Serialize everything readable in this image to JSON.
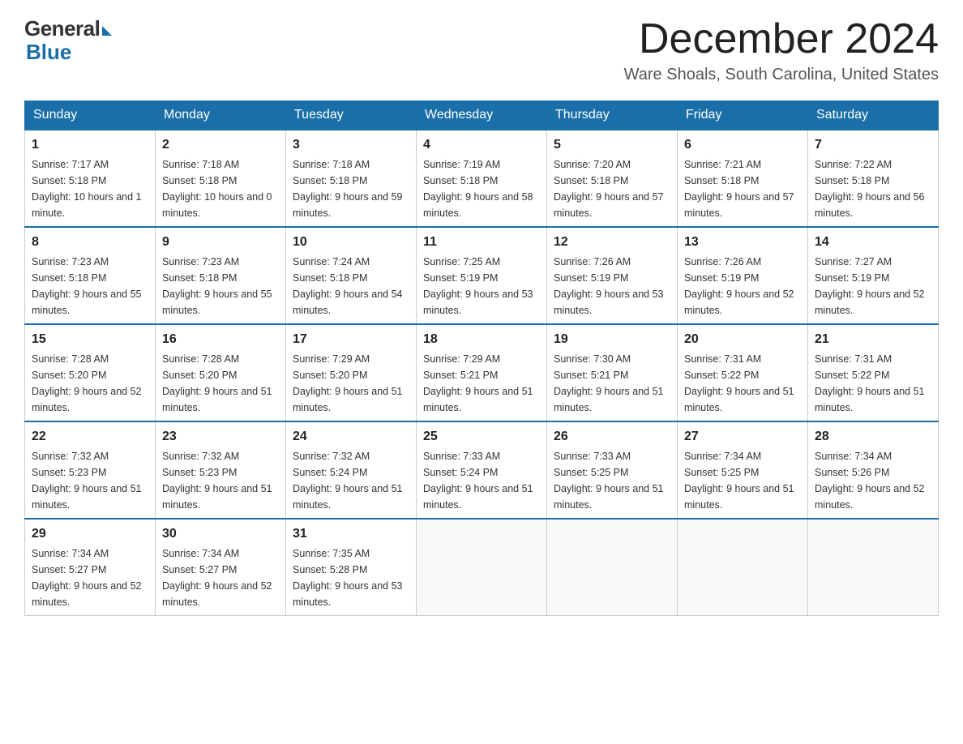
{
  "logo": {
    "general": "General",
    "blue": "Blue"
  },
  "title": {
    "month": "December 2024",
    "location": "Ware Shoals, South Carolina, United States"
  },
  "days_of_week": [
    "Sunday",
    "Monday",
    "Tuesday",
    "Wednesday",
    "Thursday",
    "Friday",
    "Saturday"
  ],
  "weeks": [
    [
      {
        "day": "1",
        "sunrise": "7:17 AM",
        "sunset": "5:18 PM",
        "daylight": "10 hours and 1 minute."
      },
      {
        "day": "2",
        "sunrise": "7:18 AM",
        "sunset": "5:18 PM",
        "daylight": "10 hours and 0 minutes."
      },
      {
        "day": "3",
        "sunrise": "7:18 AM",
        "sunset": "5:18 PM",
        "daylight": "9 hours and 59 minutes."
      },
      {
        "day": "4",
        "sunrise": "7:19 AM",
        "sunset": "5:18 PM",
        "daylight": "9 hours and 58 minutes."
      },
      {
        "day": "5",
        "sunrise": "7:20 AM",
        "sunset": "5:18 PM",
        "daylight": "9 hours and 57 minutes."
      },
      {
        "day": "6",
        "sunrise": "7:21 AM",
        "sunset": "5:18 PM",
        "daylight": "9 hours and 57 minutes."
      },
      {
        "day": "7",
        "sunrise": "7:22 AM",
        "sunset": "5:18 PM",
        "daylight": "9 hours and 56 minutes."
      }
    ],
    [
      {
        "day": "8",
        "sunrise": "7:23 AM",
        "sunset": "5:18 PM",
        "daylight": "9 hours and 55 minutes."
      },
      {
        "day": "9",
        "sunrise": "7:23 AM",
        "sunset": "5:18 PM",
        "daylight": "9 hours and 55 minutes."
      },
      {
        "day": "10",
        "sunrise": "7:24 AM",
        "sunset": "5:18 PM",
        "daylight": "9 hours and 54 minutes."
      },
      {
        "day": "11",
        "sunrise": "7:25 AM",
        "sunset": "5:19 PM",
        "daylight": "9 hours and 53 minutes."
      },
      {
        "day": "12",
        "sunrise": "7:26 AM",
        "sunset": "5:19 PM",
        "daylight": "9 hours and 53 minutes."
      },
      {
        "day": "13",
        "sunrise": "7:26 AM",
        "sunset": "5:19 PM",
        "daylight": "9 hours and 52 minutes."
      },
      {
        "day": "14",
        "sunrise": "7:27 AM",
        "sunset": "5:19 PM",
        "daylight": "9 hours and 52 minutes."
      }
    ],
    [
      {
        "day": "15",
        "sunrise": "7:28 AM",
        "sunset": "5:20 PM",
        "daylight": "9 hours and 52 minutes."
      },
      {
        "day": "16",
        "sunrise": "7:28 AM",
        "sunset": "5:20 PM",
        "daylight": "9 hours and 51 minutes."
      },
      {
        "day": "17",
        "sunrise": "7:29 AM",
        "sunset": "5:20 PM",
        "daylight": "9 hours and 51 minutes."
      },
      {
        "day": "18",
        "sunrise": "7:29 AM",
        "sunset": "5:21 PM",
        "daylight": "9 hours and 51 minutes."
      },
      {
        "day": "19",
        "sunrise": "7:30 AM",
        "sunset": "5:21 PM",
        "daylight": "9 hours and 51 minutes."
      },
      {
        "day": "20",
        "sunrise": "7:31 AM",
        "sunset": "5:22 PM",
        "daylight": "9 hours and 51 minutes."
      },
      {
        "day": "21",
        "sunrise": "7:31 AM",
        "sunset": "5:22 PM",
        "daylight": "9 hours and 51 minutes."
      }
    ],
    [
      {
        "day": "22",
        "sunrise": "7:32 AM",
        "sunset": "5:23 PM",
        "daylight": "9 hours and 51 minutes."
      },
      {
        "day": "23",
        "sunrise": "7:32 AM",
        "sunset": "5:23 PM",
        "daylight": "9 hours and 51 minutes."
      },
      {
        "day": "24",
        "sunrise": "7:32 AM",
        "sunset": "5:24 PM",
        "daylight": "9 hours and 51 minutes."
      },
      {
        "day": "25",
        "sunrise": "7:33 AM",
        "sunset": "5:24 PM",
        "daylight": "9 hours and 51 minutes."
      },
      {
        "day": "26",
        "sunrise": "7:33 AM",
        "sunset": "5:25 PM",
        "daylight": "9 hours and 51 minutes."
      },
      {
        "day": "27",
        "sunrise": "7:34 AM",
        "sunset": "5:25 PM",
        "daylight": "9 hours and 51 minutes."
      },
      {
        "day": "28",
        "sunrise": "7:34 AM",
        "sunset": "5:26 PM",
        "daylight": "9 hours and 52 minutes."
      }
    ],
    [
      {
        "day": "29",
        "sunrise": "7:34 AM",
        "sunset": "5:27 PM",
        "daylight": "9 hours and 52 minutes."
      },
      {
        "day": "30",
        "sunrise": "7:34 AM",
        "sunset": "5:27 PM",
        "daylight": "9 hours and 52 minutes."
      },
      {
        "day": "31",
        "sunrise": "7:35 AM",
        "sunset": "5:28 PM",
        "daylight": "9 hours and 53 minutes."
      },
      null,
      null,
      null,
      null
    ]
  ]
}
